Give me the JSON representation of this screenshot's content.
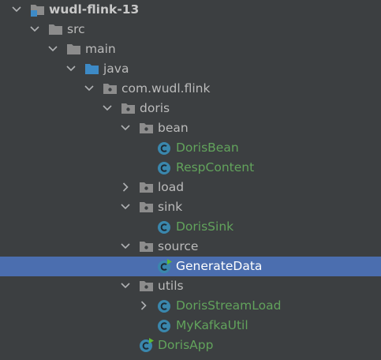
{
  "colors": {
    "background": "#3c3f41",
    "selection": "#4b6eaf",
    "text": "#bbbbbb",
    "class_text": "#62a35c",
    "folder": "#8c8c8c",
    "source_folder": "#3d8ac6",
    "class_icon": "#3a87ad"
  },
  "tree": {
    "project": {
      "label": "wudl-flink-13",
      "icon": "module-folder-icon"
    },
    "src": {
      "label": "src",
      "icon": "folder-icon"
    },
    "main": {
      "label": "main",
      "icon": "folder-icon"
    },
    "java": {
      "label": "java",
      "icon": "source-root-icon"
    },
    "package": {
      "label": "com.wudl.flink",
      "icon": "package-icon"
    },
    "doris": {
      "label": "doris",
      "icon": "package-icon"
    },
    "bean": {
      "label": "bean",
      "icon": "package-icon"
    },
    "doris_bean": {
      "label": "DorisBean",
      "icon": "class-icon"
    },
    "resp_content": {
      "label": "RespContent",
      "icon": "class-icon"
    },
    "load": {
      "label": "load",
      "icon": "package-icon"
    },
    "sink": {
      "label": "sink",
      "icon": "package-icon"
    },
    "doris_sink": {
      "label": "DorisSink",
      "icon": "class-icon"
    },
    "source": {
      "label": "source",
      "icon": "package-icon"
    },
    "generate_data": {
      "label": "GenerateData",
      "icon": "runnable-class-icon",
      "selected": true
    },
    "utils": {
      "label": "utils",
      "icon": "package-icon"
    },
    "doris_stream_load": {
      "label": "DorisStreamLoad",
      "icon": "class-icon"
    },
    "my_kafka_util": {
      "label": "MyKafkaUtil",
      "icon": "class-icon"
    },
    "doris_app": {
      "label": "DorisApp",
      "icon": "runnable-class-icon"
    }
  }
}
